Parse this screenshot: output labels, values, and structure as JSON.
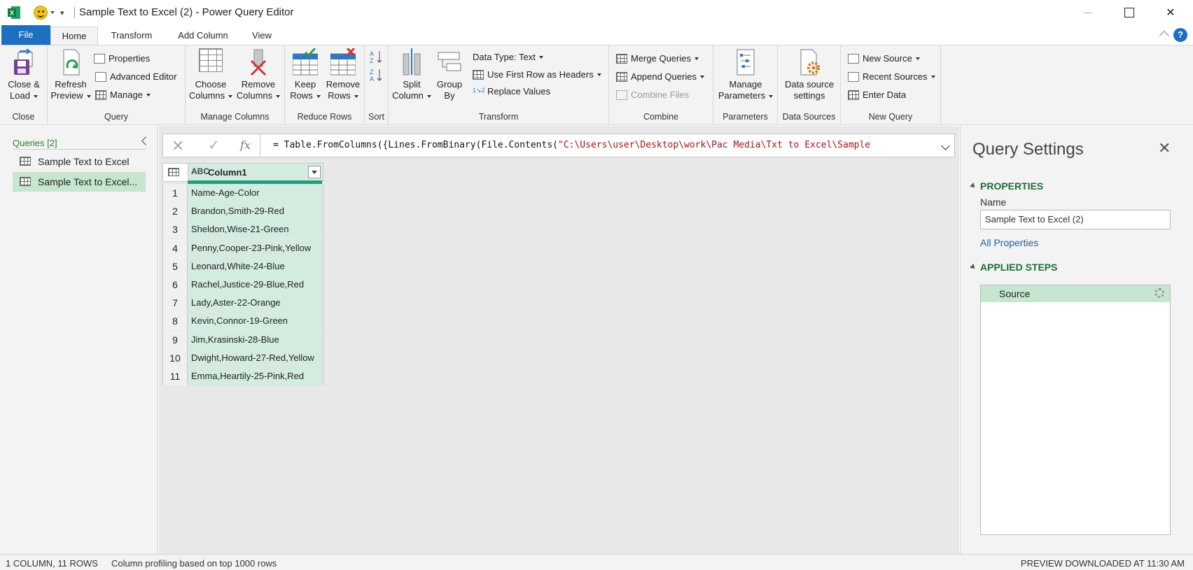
{
  "window": {
    "title": "Sample Text to Excel (2) - Power Query Editor",
    "minimize_icon": "minimize-icon",
    "maximize_icon": "maximize-icon",
    "close_glyph": "✕"
  },
  "tabs": [
    {
      "label": "File"
    },
    {
      "label": "Home"
    },
    {
      "label": "Transform"
    },
    {
      "label": "Add Column"
    },
    {
      "label": "View"
    }
  ],
  "help_label": "?",
  "ribbon": {
    "close_group": {
      "label": "Close",
      "close_load": "Close &",
      "close_load2": "Load"
    },
    "query_group": {
      "label": "Query",
      "refresh": "Refresh",
      "refresh2": "Preview",
      "properties": "Properties",
      "advanced_editor": "Advanced Editor",
      "manage": "Manage"
    },
    "manage_columns_group": {
      "label": "Manage Columns",
      "choose": "Choose",
      "choose2": "Columns",
      "remove": "Remove",
      "remove2": "Columns"
    },
    "reduce_rows_group": {
      "label": "Reduce Rows",
      "keep": "Keep",
      "keep2": "Rows",
      "remove": "Remove",
      "remove2": "Rows"
    },
    "sort_group": {
      "label": "Sort"
    },
    "transform_group": {
      "label": "Transform",
      "split": "Split",
      "split2": "Column",
      "group": "Group",
      "group2": "By",
      "data_type": "Data Type: Text",
      "first_row": "Use First Row as Headers",
      "replace": "Replace Values"
    },
    "combine_group": {
      "label": "Combine",
      "merge": "Merge Queries",
      "append": "Append Queries",
      "combine_files": "Combine Files"
    },
    "parameters_group": {
      "label": "Parameters",
      "manage": "Manage",
      "manage2": "Parameters"
    },
    "data_sources_group": {
      "label": "Data Sources",
      "settings": "Data source",
      "settings2": "settings"
    },
    "new_query_group": {
      "label": "New Query",
      "new_source": "New Source",
      "recent": "Recent Sources",
      "enter": "Enter Data"
    }
  },
  "queries_pane": {
    "header": "Queries [2]",
    "items": [
      {
        "label": "Sample Text to Excel",
        "selected": false
      },
      {
        "label": "Sample Text to Excel...",
        "selected": true
      }
    ]
  },
  "formula_bar": {
    "fx": "fx",
    "prefix": "= Table.FromColumns({Lines.FromBinary(File.Contents(",
    "string": "\"C:\\Users\\user\\Desktop\\work\\Pac Media\\Txt to Excel\\Sample"
  },
  "table": {
    "column_type": "ABC",
    "column_name": "Column1",
    "rows": [
      {
        "n": "1",
        "v": "Name-Age-Color"
      },
      {
        "n": "2",
        "v": "Brandon,Smith-29-Red"
      },
      {
        "n": "3",
        "v": "Sheldon,Wise-21-Green"
      },
      {
        "n": "4",
        "v": "Penny,Cooper-23-Pink,Yellow"
      },
      {
        "n": "5",
        "v": "Leonard,White-24-Blue"
      },
      {
        "n": "6",
        "v": "Rachel,Justice-29-Blue,Red"
      },
      {
        "n": "7",
        "v": "Lady,Aster-22-Orange"
      },
      {
        "n": "8",
        "v": "Kevin,Connor-19-Green"
      },
      {
        "n": "9",
        "v": "Jim,Krasinski-28-Blue"
      },
      {
        "n": "10",
        "v": "Dwight,Howard-27-Red,Yellow"
      },
      {
        "n": "11",
        "v": "Emma,Heartily-25-Pink,Red"
      }
    ]
  },
  "query_settings": {
    "title": "Query Settings",
    "properties_header": "PROPERTIES",
    "name_label": "Name",
    "name_value": "Sample Text to Excel (2)",
    "all_properties": "All Properties",
    "applied_steps_header": "APPLIED STEPS",
    "steps": [
      {
        "label": "Source"
      }
    ]
  },
  "status": {
    "left": "1 COLUMN, 11 ROWS",
    "middle": "Column profiling based on top 1000 rows",
    "right": "PREVIEW DOWNLOADED AT 11:30 AM"
  },
  "colors": {
    "accent_blue": "#1d6fbf",
    "selection_green": "#c6e6cf",
    "header_green": "#1f6b3a"
  }
}
